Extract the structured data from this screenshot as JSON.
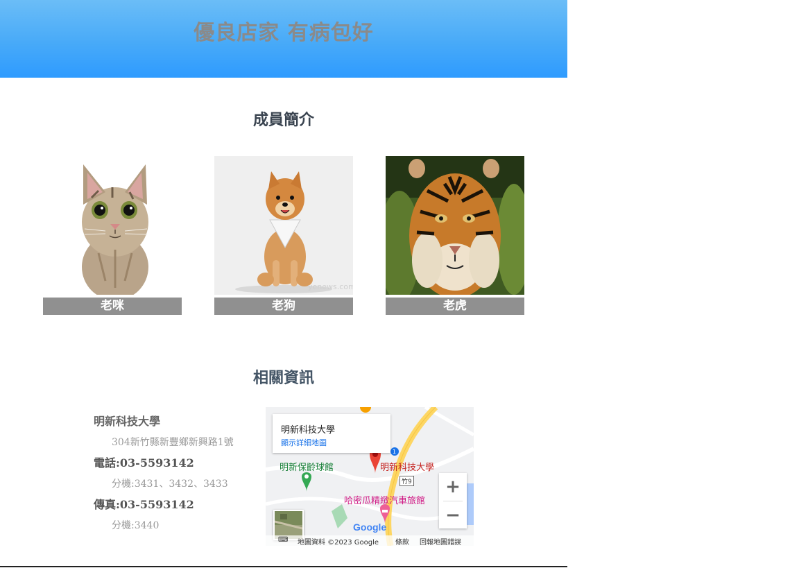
{
  "banner": {
    "title": "優良店家 有病包好"
  },
  "members": {
    "heading": "成員簡介",
    "items": [
      {
        "label": "老咪",
        "icon": "cat-photo"
      },
      {
        "label": "老狗",
        "icon": "dog-photo",
        "watermark": "yenews.com"
      },
      {
        "label": "老虎",
        "icon": "tiger-photo"
      }
    ]
  },
  "info": {
    "heading": "相關資訊",
    "school": "明新科技大學",
    "address": "304新竹縣新豐鄉新興路1號",
    "phone": "電話:03-5593142",
    "phone_ext": "分機:3431、3432、3433",
    "fax": "傳真:03-5593142",
    "fax_ext": "分機:3440"
  },
  "map": {
    "info_place": "明新科技大學",
    "info_link": "顯示詳細地圖",
    "poi_green": "明新保齡球館",
    "poi_red": "明新科技大學",
    "poi_pink": "哈密瓜精緻汽車旅館",
    "road_label": "竹9",
    "zoom_in": "+",
    "zoom_out": "−",
    "google": "Google",
    "footer_data": "地圖資料 ©2023 Google",
    "footer_terms": "條款",
    "footer_report": "回報地圖錯誤",
    "colors": {
      "marker": "#ea4335",
      "road_major": "#fdd663",
      "water": "#aecbfa",
      "park": "#a8dab5"
    }
  }
}
